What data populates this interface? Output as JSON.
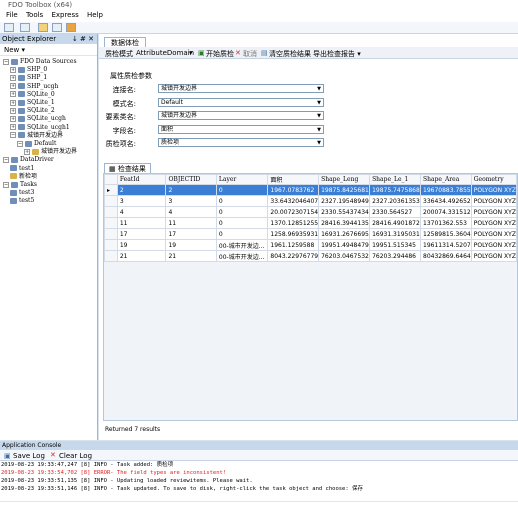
{
  "window": {
    "title": "FDO Toolbox (x64)"
  },
  "menu": [
    "File",
    "Tools",
    "Express",
    "Help"
  ],
  "explorer": {
    "title": "Object Explorer",
    "pin": "↓ # ✕",
    "new_label": "New ▾",
    "tree": [
      {
        "label": "FDO Data Sources",
        "exp": "−",
        "kind": "blue",
        "level": 0
      },
      {
        "label": "SHP_0",
        "exp": "+",
        "kind": "blue",
        "level": 1
      },
      {
        "label": "SHP_1",
        "exp": "+",
        "kind": "blue",
        "level": 1
      },
      {
        "label": "SHP_ucgh",
        "exp": "+",
        "kind": "blue",
        "level": 1
      },
      {
        "label": "SQLite_0",
        "exp": "+",
        "kind": "blue",
        "level": 1
      },
      {
        "label": "SQLite_1",
        "exp": "+",
        "kind": "blue",
        "level": 1
      },
      {
        "label": "SQLite_2",
        "exp": "+",
        "kind": "blue",
        "level": 1
      },
      {
        "label": "SQLite_ucgh",
        "exp": "+",
        "kind": "blue",
        "level": 1
      },
      {
        "label": "SQLite_ucgh1",
        "exp": "+",
        "kind": "blue",
        "level": 1
      },
      {
        "label": "城镇开发边界",
        "exp": "−",
        "kind": "blue",
        "level": 1
      },
      {
        "label": "Default",
        "exp": "−",
        "kind": "blue",
        "level": 2
      },
      {
        "label": "城镇开发边界",
        "exp": "+",
        "kind": "yel",
        "level": 3
      },
      {
        "label": "DataDriver",
        "exp": "−",
        "kind": "blue",
        "level": 0
      },
      {
        "label": "test1",
        "exp": "",
        "kind": "blue",
        "level": 1
      },
      {
        "label": "新检项",
        "exp": "",
        "kind": "yel",
        "level": 1
      },
      {
        "label": "Tasks",
        "exp": "−",
        "kind": "blue",
        "level": 0
      },
      {
        "label": "test3",
        "exp": "",
        "kind": "blue",
        "level": 1
      },
      {
        "label": "test5",
        "exp": "",
        "kind": "blue",
        "level": 1
      }
    ]
  },
  "doc": {
    "tab": "数据体检",
    "bar": {
      "mode_label": "质检模式",
      "mode_value": "AttributeDomain",
      "start": "开始质检",
      "cancel": "取消",
      "clear": "清空质检结果",
      "export": "导出检查报告 ▾"
    },
    "settings_title": "属性质检参数",
    "fields": [
      {
        "label": "连接名:",
        "value": "城镇开发边界"
      },
      {
        "label": "模式名:",
        "value": "Default"
      },
      {
        "label": "要素类名:",
        "value": "城镇开发边界"
      },
      {
        "label": "字段名:",
        "value": "面积"
      },
      {
        "label": "质检项名:",
        "value": "质检项"
      }
    ],
    "results_tab": "检查结果",
    "columns": [
      "FeatId",
      "OBJECTID",
      "Layer",
      "面积",
      "Shape_Leng",
      "Shape_Le_1",
      "Shape_Area",
      "Geometry"
    ],
    "rows": [
      [
        "2",
        "2",
        "0",
        "1967.0783762",
        "19875.8425681",
        "19875.7475868",
        "19670883.7855",
        "POLYGON XYZ"
      ],
      [
        "3",
        "3",
        "0",
        "33.6432046407",
        "2327.19548949",
        "2327.20361353",
        "336434.492652",
        "POLYGON XYZ"
      ],
      [
        "4",
        "4",
        "0",
        "20.0072307154",
        "2330.55437434",
        "2330.564527",
        "200074.331512",
        "POLYGON XYZ"
      ],
      [
        "11",
        "11",
        "0",
        "1370.12851255",
        "28416.3944135",
        "28416.4901872",
        "13701362.553",
        "POLYGON XYZ"
      ],
      [
        "17",
        "17",
        "0",
        "1258.96935931",
        "16931.2676695",
        "16931.3195031",
        "12589815.3604",
        "POLYGON XYZ"
      ],
      [
        "19",
        "19",
        "00-城市开发边...",
        "1961.1259588",
        "19951.4948479",
        "19951.515345",
        "19611314.5207",
        "POLYGON XYZ"
      ],
      [
        "21",
        "21",
        "00-城市开发边...",
        "8043.22976779",
        "76203.0467532",
        "76203.294486",
        "80432869.6464",
        "POLYGON XYZ"
      ]
    ],
    "selected_row": 0,
    "returned": "Returned 7 results"
  },
  "console": {
    "title": "Application Console",
    "save": "Save Log",
    "clear": "Clear Log",
    "lines": [
      {
        "text": "2019-08-23 19:33:47,247 [8] INFO - Task added: 质检项",
        "err": false
      },
      {
        "text": "2019-08-23 19:33:54,702 [8] ERROR- The field types are inconsistent!",
        "err": true
      },
      {
        "text": "2019-08-23 19:33:51,135 [8] INFO - Updating loaded reviewitems. Please wait.",
        "err": false
      },
      {
        "text": "2019-08-23 19:33:51,146 [8] INFO - Task updated. To save to disk, right-click the task object and choose: 保存",
        "err": false
      }
    ]
  }
}
